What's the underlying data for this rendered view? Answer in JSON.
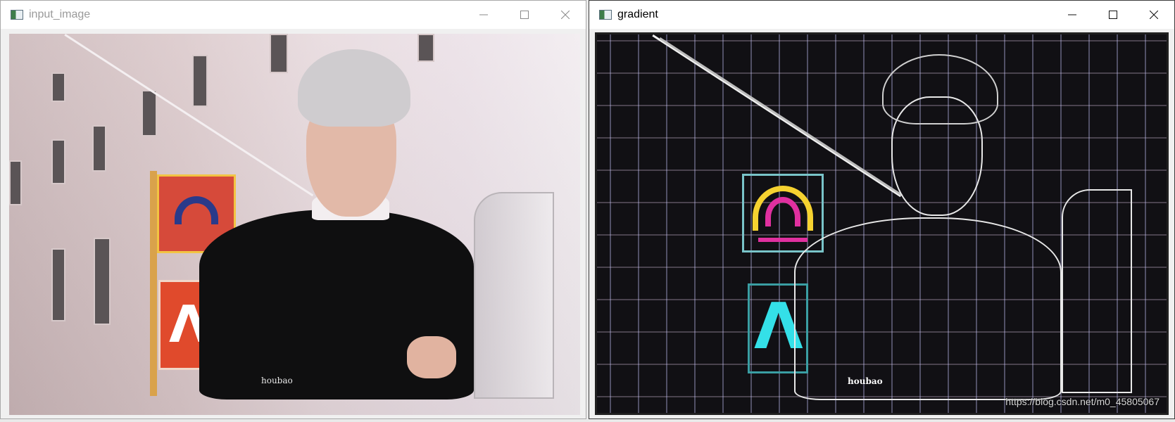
{
  "windows": [
    {
      "title": "input_image",
      "controls": {
        "minimize": "minimize-icon",
        "maximize": "maximize-icon",
        "close": "close-icon"
      },
      "image": {
        "watermark": "houbao"
      }
    },
    {
      "title": "gradient",
      "controls": {
        "minimize": "minimize-icon",
        "maximize": "maximize-icon",
        "close": "close-icon"
      },
      "image": {
        "watermark": "houbao"
      },
      "url_overlay": "https://blog.csdn.net/m0_45805067"
    }
  ]
}
